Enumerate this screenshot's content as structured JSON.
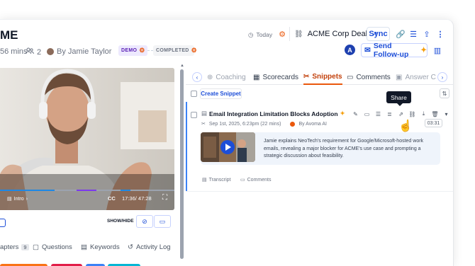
{
  "header": {
    "title": "ME",
    "duration": "56 mins",
    "participants": "2",
    "owner": "By Jamie Taylor",
    "stage_demo": "DEMO",
    "stage_completed": "COMPLETED"
  },
  "topbar": {
    "today": "Today",
    "deal": "ACME Corp Deal",
    "sync": "Sync",
    "avatar_initial": "A",
    "follow_up": "Send Follow-up"
  },
  "video": {
    "chapter": "Intro",
    "time": "17:36/ 47:28",
    "cc": "CC",
    "show_hide": "SHOW/HIDE"
  },
  "bottom_tabs": {
    "chapters": "apters",
    "chapters_count": "9",
    "questions": "Questions",
    "keywords": "Keywords",
    "activity_log": "Activity Log"
  },
  "tabs": {
    "coaching": "Coaching",
    "scorecards": "Scorecards",
    "snippets": "Snippets",
    "comments": "Comments",
    "answer": "Answer C"
  },
  "snippets": {
    "create_label": "Create Snippet",
    "tooltip": "Share",
    "item": {
      "title": "Email Integration Limitation Blocks Adoption",
      "date": "Sep 1st, 2025, 6:23pm (22 mins)",
      "author": "By Avoma AI",
      "duration": "03:31",
      "description": "Jamie explains NeoTech's requirement for Google/Microsoft-hosted work emails, revealing a major blocker for ACME's use case and prompting a strategic discussion about feasibility.",
      "transcript_label": "Transcript",
      "comments_label": "Comments"
    }
  },
  "colors": {
    "accent": "#ea580c",
    "link": "#1d4ed8",
    "snippet_border": "#3b82f6",
    "timeline_segments": [
      "#f97316",
      "#e11d48",
      "#3b82f6",
      "#06b6d4"
    ],
    "progress_played": "#1e88e5",
    "progress_chapter": "#7c3aed"
  },
  "icons": [
    "clock-icon",
    "hubspot-icon",
    "link-icon",
    "external-link-icon",
    "copy-link-icon",
    "kebab-menu-icon",
    "mail-icon",
    "sparkle-icon",
    "layout-icon",
    "edit-icon",
    "share-icon",
    "download-icon",
    "trash-icon",
    "play-icon",
    "fullscreen-icon",
    "hand-cursor-icon"
  ]
}
